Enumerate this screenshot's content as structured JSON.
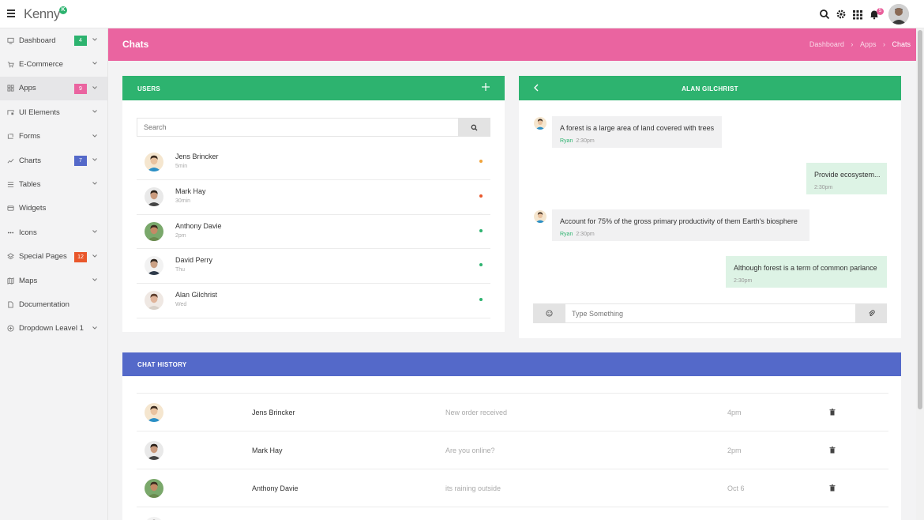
{
  "app": {
    "logo": "Kenny",
    "logo_badge": "K"
  },
  "topbar": {
    "notification_count": "5"
  },
  "colors": {
    "pink": "#ea64a0",
    "green": "#2db36f",
    "blue": "#5469c9",
    "orange": "#e9572b",
    "online": "#2db36f",
    "away": "#f0a33a",
    "busy": "#e9572b"
  },
  "sidebar": {
    "items": [
      {
        "label": "Dashboard",
        "icon": "monitor-icon",
        "badge": "4",
        "badge_color": "#2db36f",
        "chevron": true
      },
      {
        "label": "E-Commerce",
        "icon": "cart-icon",
        "badge": "",
        "chevron": true
      },
      {
        "label": "Apps",
        "icon": "grid-icon",
        "badge": "9",
        "badge_color": "#ea64a0",
        "chevron": true,
        "active": true
      },
      {
        "label": "UI Elements",
        "icon": "elements-icon",
        "badge": "",
        "chevron": true
      },
      {
        "label": "Forms",
        "icon": "forms-icon",
        "badge": "",
        "chevron": true
      },
      {
        "label": "Charts",
        "icon": "chart-icon",
        "badge": "7",
        "badge_color": "#5469c9",
        "chevron": true
      },
      {
        "label": "Tables",
        "icon": "list-icon",
        "badge": "",
        "chevron": true
      },
      {
        "label": "Widgets",
        "icon": "widgets-icon",
        "badge": "",
        "chevron": false
      },
      {
        "label": "Icons",
        "icon": "dots-icon",
        "badge": "",
        "chevron": true
      },
      {
        "label": "Special Pages",
        "icon": "layers-icon",
        "badge": "12",
        "badge_color": "#e9572b",
        "chevron": true
      },
      {
        "label": "Maps",
        "icon": "map-icon",
        "badge": "",
        "chevron": true
      },
      {
        "label": "Documentation",
        "icon": "document-icon",
        "badge": "",
        "chevron": false
      },
      {
        "label": "Dropdown Leavel 1",
        "icon": "plus-circle-icon",
        "badge": "",
        "chevron": true
      }
    ]
  },
  "page": {
    "title": "Chats",
    "breadcrumb": [
      "Dashboard",
      "Apps",
      "Chats"
    ]
  },
  "users_panel": {
    "title": "USERS",
    "search_placeholder": "Search",
    "users": [
      {
        "name": "Jens Brincker",
        "time": "5min",
        "status": "away"
      },
      {
        "name": "Mark Hay",
        "time": "30min",
        "status": "busy"
      },
      {
        "name": "Anthony Davie",
        "time": "2pm",
        "status": "online"
      },
      {
        "name": "David Perry",
        "time": "Thu",
        "status": "online"
      },
      {
        "name": "Alan Gilchrist",
        "time": "Wed",
        "status": "online"
      }
    ]
  },
  "chat_panel": {
    "title": "ALAN GILCHRIST",
    "messages": [
      {
        "text": "A forest is a large area of land covered with trees",
        "sender": "Ryan",
        "time": "2:30pm",
        "direction": "in"
      },
      {
        "text": "Provide ecosystem...",
        "sender": "",
        "time": "2:30pm",
        "direction": "out"
      },
      {
        "text": "Account for 75% of the gross primary productivity of them Earth's biosphere",
        "sender": "Ryan",
        "time": "2:30pm",
        "direction": "in"
      },
      {
        "text": "Although forest is a term of common parlance",
        "sender": "",
        "time": "2:30pm",
        "direction": "out"
      }
    ],
    "input_placeholder": "Type Something"
  },
  "history_panel": {
    "title": "CHAT HISTORY",
    "rows": [
      {
        "name": "Jens Brincker",
        "message": "New order received",
        "time": "4pm"
      },
      {
        "name": "Mark Hay",
        "message": "Are you online?",
        "time": "2pm"
      },
      {
        "name": "Anthony Davie",
        "message": "its raining outside",
        "time": "Oct 6"
      }
    ]
  }
}
